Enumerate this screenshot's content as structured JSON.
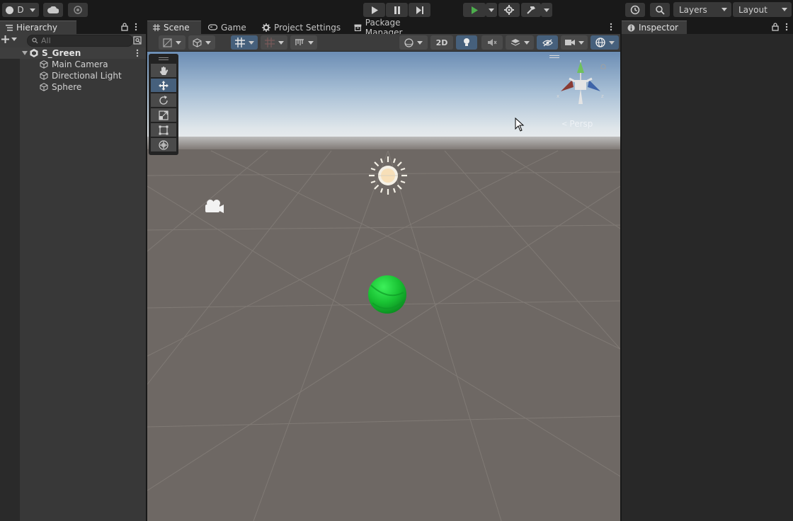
{
  "toolbar": {
    "account_label": "D",
    "layers_label": "Layers",
    "layout_label": "Layout"
  },
  "hierarchy": {
    "tab_label": "Hierarchy",
    "search_placeholder": "All",
    "scene_name": "S_Green",
    "items": [
      {
        "label": "Main Camera"
      },
      {
        "label": "Directional Light"
      },
      {
        "label": "Sphere"
      }
    ]
  },
  "scene_view": {
    "tabs": [
      {
        "label": "Scene",
        "icon": "grid-icon"
      },
      {
        "label": "Game",
        "icon": "gamepad-icon"
      },
      {
        "label": "Project Settings",
        "icon": "gear-icon"
      },
      {
        "label": "Package Manager",
        "icon": "package-icon"
      }
    ],
    "toggle_2d_label": "2D",
    "projection_label": "Persp",
    "tools": [
      "hand-tool",
      "move-tool",
      "rotate-tool",
      "scale-tool",
      "rect-tool",
      "transform-tool"
    ]
  },
  "inspector": {
    "tab_label": "Inspector"
  },
  "colors": {
    "accent_blue": "#46607c",
    "play_green": "#4cae4c",
    "sphere_green": "#1ec83a",
    "ground": "#6e6864",
    "sky_top": "#6b8db4"
  }
}
